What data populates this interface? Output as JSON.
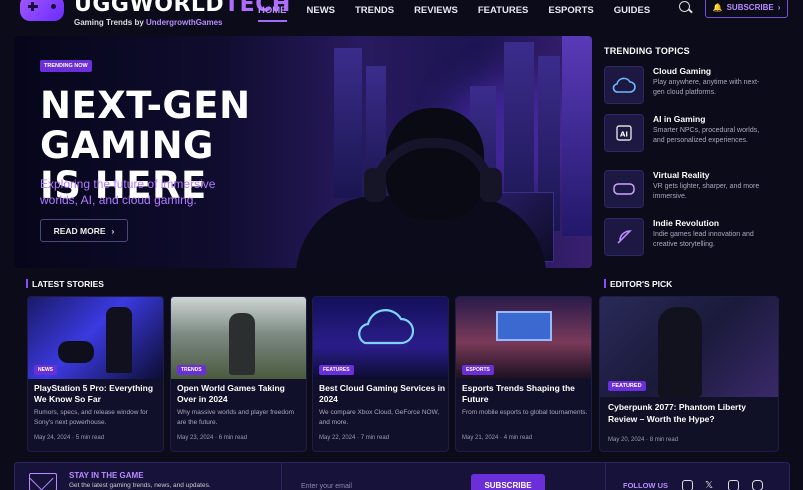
{
  "brand": {
    "name_a": "UGGWORLD",
    "name_b": "TECH",
    "tagline_a": "Gaming Trends by ",
    "tagline_b": "UndergrowthGames"
  },
  "nav": [
    "HOME",
    "NEWS",
    "TRENDS",
    "REVIEWS",
    "FEATURES",
    "ESPORTS",
    "GUIDES"
  ],
  "nav_active": "HOME",
  "subscribe_label": "SUBSCRIBE",
  "hero": {
    "badge": "TRENDING NOW",
    "title_l1": "NEXT-GEN GAMING",
    "title_l2": "IS HERE",
    "subtitle": "Exploring the future of immersive worlds, AI, and cloud gaming.",
    "cta": "READ MORE"
  },
  "trending": {
    "title": "TRENDING TOPICS",
    "items": [
      {
        "icon": "cloud-icon",
        "title": "Cloud Gaming",
        "desc": "Play anywhere, anytime with next-gen cloud platforms."
      },
      {
        "icon": "ai-chip-icon",
        "title": "AI in Gaming",
        "desc": "Smarter NPCs, procedural worlds, and personalized experiences."
      },
      {
        "icon": "vr-headset-icon",
        "title": "Virtual Reality",
        "desc": "VR gets lighter, sharper, and more immersive."
      },
      {
        "icon": "feather-icon",
        "title": "Indie Revolution",
        "desc": "Indie games lead innovation and creative storytelling."
      }
    ]
  },
  "latest": {
    "title": "LATEST STORIES",
    "cards": [
      {
        "tag": "NEWS",
        "title": "PlayStation 5 Pro: Everything We Know So Far",
        "desc": "Rumors, specs, and release window for Sony's next powerhouse.",
        "date": "May 24, 2024",
        "read": "5 min read"
      },
      {
        "tag": "TRENDS",
        "title": "Open World Games Taking Over in 2024",
        "desc": "Why massive worlds and player freedom are the future.",
        "date": "May 23, 2024",
        "read": "6 min read"
      },
      {
        "tag": "FEATURES",
        "title": "Best Cloud Gaming Services in 2024",
        "desc": "We compare Xbox Cloud, GeForce NOW, and more.",
        "date": "May 22, 2024",
        "read": "7 min read"
      },
      {
        "tag": "ESPORTS",
        "title": "Esports Trends Shaping the Future",
        "desc": "From mobile esports to global tournaments.",
        "date": "May 21, 2024",
        "read": "4 min read"
      }
    ]
  },
  "pick": {
    "title": "EDITOR'S PICK",
    "tag": "FEATURED",
    "headline": "Cyberpunk 2077: Phantom Liberty Review – Worth the Hype?",
    "date": "May 20, 2024",
    "read": "8 min read"
  },
  "newsletter": {
    "title": "STAY IN THE GAME",
    "desc": "Get the latest gaming trends, news, and updates.",
    "placeholder": "Enter your email",
    "button": "SUBSCRIBE",
    "follow": "FOLLOW US"
  },
  "colors": {
    "accent": "#6a2fd8",
    "accent_light": "#b98bff",
    "bg": "#0b0b1a"
  }
}
